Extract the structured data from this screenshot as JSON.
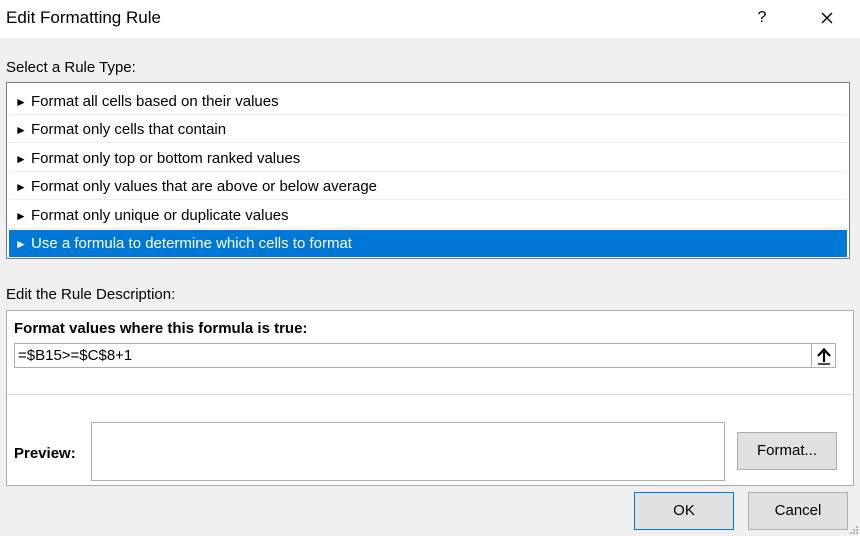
{
  "dialog": {
    "title": "Edit Formatting Rule",
    "help_label": "?"
  },
  "rule_type": {
    "label": "Select a Rule Type:",
    "items": [
      "Format all cells based on their values",
      "Format only cells that contain",
      "Format only top or bottom ranked values",
      "Format only values that are above or below average",
      "Format only unique or duplicate values",
      "Use a formula to determine which cells to format"
    ],
    "selected_index": 5,
    "arrow_glyph": "►"
  },
  "description": {
    "label": "Edit the Rule Description:",
    "heading": "Format values where this formula is true:",
    "formula": "=$B15>=$C$8+1",
    "preview_label": "Preview:",
    "format_button": "Format..."
  },
  "footer": {
    "ok_label": "OK",
    "cancel_label": "Cancel"
  },
  "colors": {
    "selection": "#0078d7",
    "dialog_bg": "#f0f0f0"
  }
}
